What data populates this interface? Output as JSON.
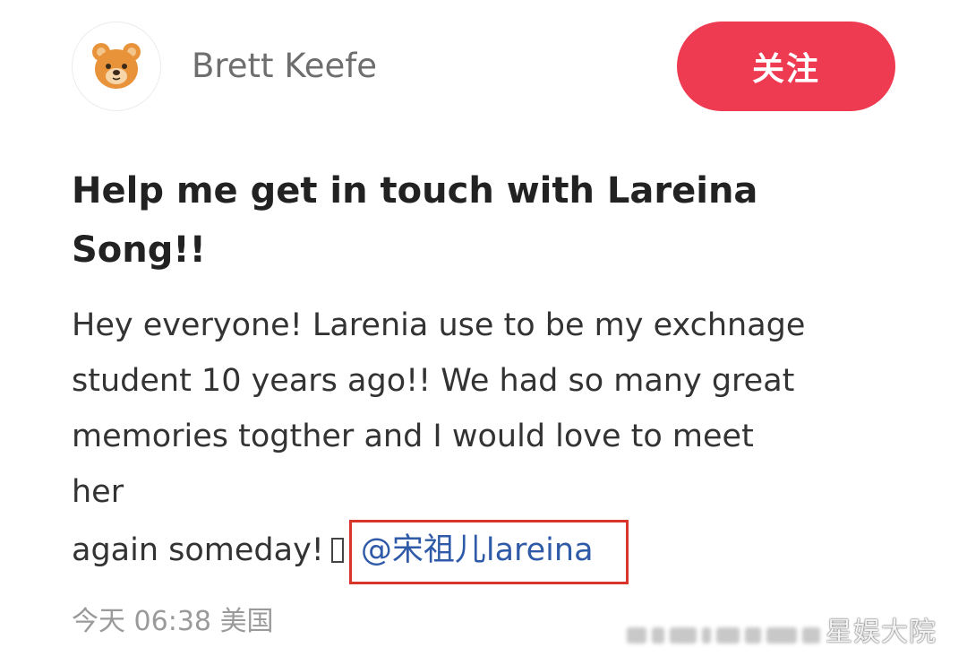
{
  "post": {
    "author": {
      "name": "Brett Keefe",
      "avatar_icon": "bear-face-icon"
    },
    "follow_button": {
      "label": "关注",
      "color": "#ee3b52"
    },
    "title": "Help me get in touch with Lareina Song!!",
    "body": {
      "line1": "Hey everyone! Larenia use to be my exchnage",
      "line2": "student 10 years ago!! We had so many great",
      "line3": "memories togther and I would love to meet",
      "line4": "her",
      "line5": "again someday!",
      "mention": "@宋祖儿lareina",
      "mention_color": "#2f5aa8",
      "highlight_color": "#d8352b"
    },
    "meta": {
      "day": "今天",
      "time": "06:38",
      "location": "美国"
    }
  },
  "watermark": "星娱大院"
}
